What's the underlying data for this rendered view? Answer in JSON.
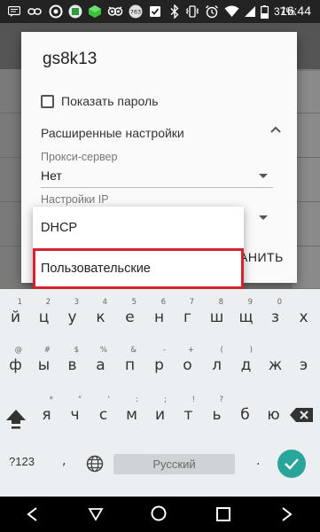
{
  "status_bar": {
    "time": "16:44",
    "battery": "37%",
    "icons": [
      "message-icon",
      "link-icon",
      "ring-icon",
      "cube-icon",
      "owl-icon",
      "badge-icon",
      "check-icon",
      "bluetooth-icon",
      "vibrate-icon",
      "alarm-icon",
      "wifi-icon",
      "signal-icon",
      "battery-icon"
    ],
    "badge_text": "763"
  },
  "dialog": {
    "title": "gs8k13",
    "show_password_label": "Показать пароль",
    "advanced_settings_label": "Расширенные настройки",
    "proxy": {
      "label": "Прокси-сервер",
      "value": "Нет"
    },
    "ip_settings_label": "Настройки IP",
    "save_button_partial": "АНИТЬ"
  },
  "dropdown": {
    "options": [
      "DHCP",
      "Пользовательские"
    ],
    "highlighted_index": 1,
    "highlight_color": "#d9202f"
  },
  "keyboard": {
    "row1": [
      {
        "key": "й",
        "hint": "1"
      },
      {
        "key": "ц",
        "hint": "2"
      },
      {
        "key": "у",
        "hint": "3"
      },
      {
        "key": "к",
        "hint": "4"
      },
      {
        "key": "е",
        "hint": "5"
      },
      {
        "key": "н",
        "hint": "6"
      },
      {
        "key": "г",
        "hint": "7"
      },
      {
        "key": "ш",
        "hint": "8"
      },
      {
        "key": "щ",
        "hint": "9"
      },
      {
        "key": "з",
        "hint": "0"
      },
      {
        "key": "х",
        "hint": ""
      }
    ],
    "row2": [
      {
        "key": "ф",
        "hint": "@"
      },
      {
        "key": "ы",
        "hint": "#"
      },
      {
        "key": "в",
        "hint": "$"
      },
      {
        "key": "а",
        "hint": "%"
      },
      {
        "key": "п",
        "hint": "&"
      },
      {
        "key": "р",
        "hint": "-"
      },
      {
        "key": "о",
        "hint": "+"
      },
      {
        "key": "л",
        "hint": "("
      },
      {
        "key": "д",
        "hint": ")"
      },
      {
        "key": "ж",
        "hint": ""
      },
      {
        "key": "э",
        "hint": ""
      }
    ],
    "row3": [
      {
        "key": "я",
        "hint": "*"
      },
      {
        "key": "ч",
        "hint": "\""
      },
      {
        "key": "с",
        "hint": "'"
      },
      {
        "key": "м",
        "hint": ":"
      },
      {
        "key": "и",
        "hint": ";"
      },
      {
        "key": "т",
        "hint": "!"
      },
      {
        "key": "ь",
        "hint": "?"
      },
      {
        "key": "б",
        "hint": ""
      },
      {
        "key": "ю",
        "hint": ""
      }
    ],
    "symbols_key": "?123",
    "comma_key": ",",
    "space_label": "Русский",
    "period_key": ".",
    "accent_color": "#2aa59a"
  },
  "navbar": {
    "icons": [
      "back-icon",
      "home-icon",
      "recents-icon"
    ]
  }
}
